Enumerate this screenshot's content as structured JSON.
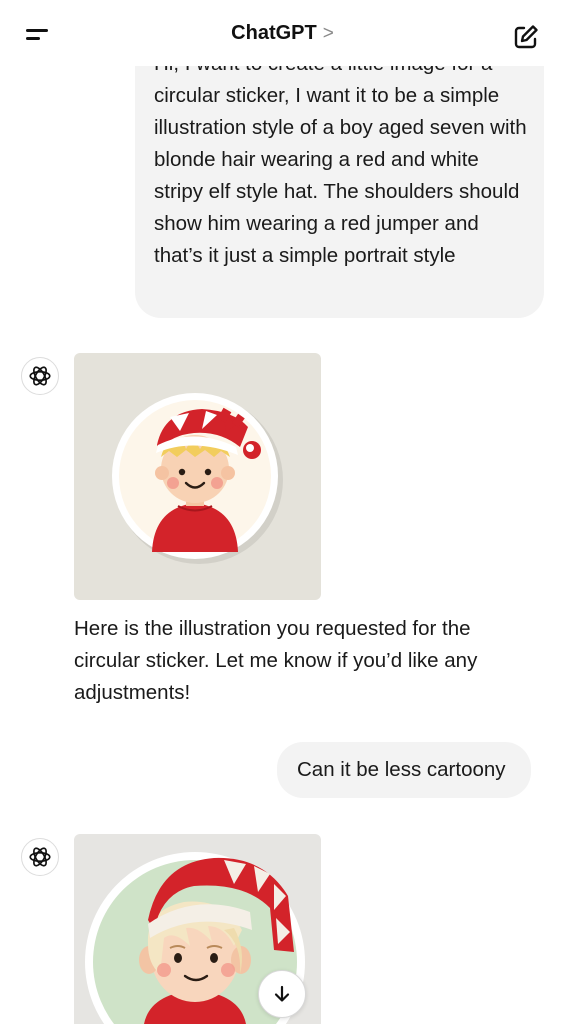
{
  "header": {
    "title": "ChatGPT",
    "chevron": ">"
  },
  "icons": {
    "menu": "menu-icon",
    "new_chat": "edit-icon",
    "assistant": "openai-logo-icon",
    "scroll": "arrow-down-icon"
  },
  "messages": [
    {
      "role": "user",
      "text": "Hi, I want to create a little image for a circular sticker, I want it to be a simple illustration style of a boy aged seven with blonde hair wearing a red and white stripy elf style hat. The shoulders should show him wearing a red jumper and that’s it just a simple portrait style"
    },
    {
      "role": "assistant",
      "text": "Here is the illustration you requested for the circular sticker. Let me know if you’d like any adjustments!"
    },
    {
      "role": "user",
      "text": "Can it be less cartoony"
    },
    {
      "role": "assistant",
      "text": ""
    }
  ],
  "colors": {
    "bubble": "#f3f3f3",
    "hat_red": "#d3232a",
    "hair": "#f2cd5d"
  }
}
